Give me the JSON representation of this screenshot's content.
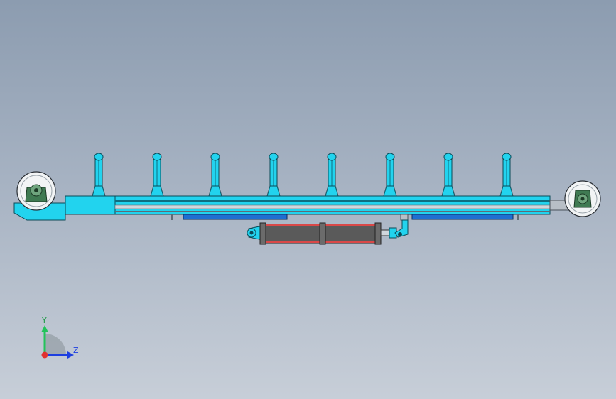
{
  "colors": {
    "background_top": "#8c9cb0",
    "background_bottom": "#c7ced8",
    "frame": "#22d3ee",
    "rail_dark": "#5f6b76",
    "rail_light": "#cfd6dc",
    "guide_blue": "#1f6fd1",
    "cylinder_body": "#5a5a5a",
    "cylinder_band": "#d94848",
    "bearing_green": "#3f7a52",
    "axis_y": "#22c35a",
    "axis_z": "#1d3fe0",
    "axis_x": "#e03030"
  },
  "triad": {
    "y_label": "Y",
    "z_label": "Z"
  },
  "model": {
    "roller_post_count": 8,
    "components": [
      "base-frame",
      "roller-post",
      "left-bearing-wheel",
      "right-bearing-wheel",
      "linear-guide",
      "hydraulic-cylinder"
    ]
  }
}
